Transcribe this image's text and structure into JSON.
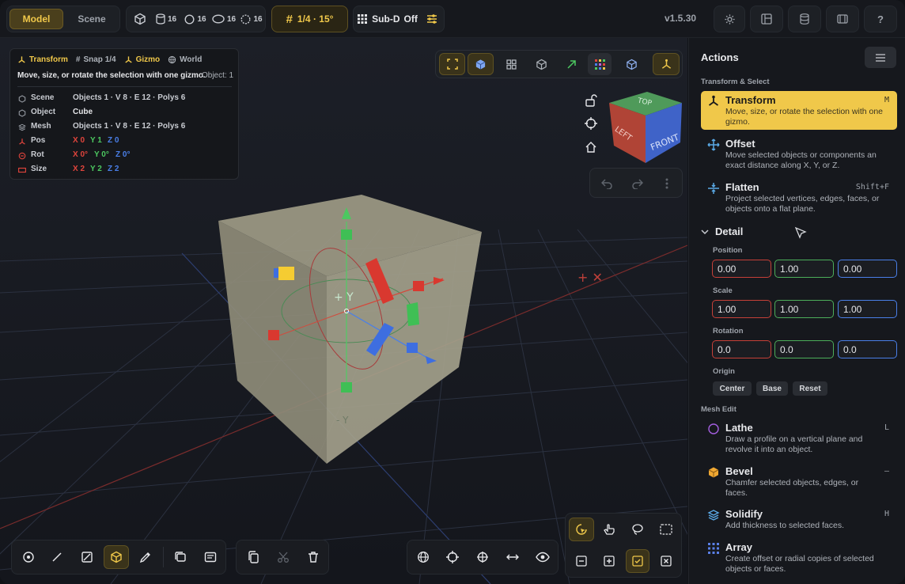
{
  "topbar": {
    "mode_tabs": [
      "Model",
      "Scene"
    ],
    "counts": [
      "16",
      "16",
      "16",
      "16"
    ],
    "snap_label": "1/4 · 15°",
    "subd_label": "Sub-D",
    "subd_state": "Off",
    "version": "v1.5.30"
  },
  "info": {
    "chips": [
      "Transform",
      "Snap 1/4",
      "Gizmo",
      "World"
    ],
    "desc": "Move, size, or rotate the selection with one gizmo.",
    "object_count": "Object: 1",
    "rows": {
      "scene": {
        "label": "Scene",
        "value": "Objects 1 · V 8 · E 12 · Polys 6"
      },
      "object": {
        "label": "Object",
        "value": "Cube"
      },
      "mesh": {
        "label": "Mesh",
        "value": "Objects 1 · V 8 · E 12 · Polys 6"
      },
      "pos": {
        "label": "Pos",
        "x": "X 0",
        "y": "Y 1",
        "z": "Z 0"
      },
      "rot": {
        "label": "Rot",
        "x": "X 0°",
        "y": "Y 0°",
        "z": "Z 0°"
      },
      "size": {
        "label": "Size",
        "x": "X 2",
        "y": "Y 2",
        "z": "Z 2"
      }
    }
  },
  "viewcube": {
    "top": "TOP",
    "left": "LEFT",
    "front": "FRONT"
  },
  "panel": {
    "title": "Actions",
    "section_transform": "Transform & Select",
    "actions": [
      {
        "title": "Transform",
        "desc": "Move, size, or rotate the selection with one gizmo.",
        "key": "M"
      },
      {
        "title": "Offset",
        "desc": "Move selected objects or components an exact distance along X, Y, or Z.",
        "key": ""
      },
      {
        "title": "Flatten",
        "desc": "Project selected vertices, edges, faces, or objects onto a flat plane.",
        "key": "Shift+F"
      }
    ],
    "detail": {
      "title": "Detail",
      "position_label": "Position",
      "position": [
        "0.00",
        "1.00",
        "0.00"
      ],
      "scale_label": "Scale",
      "scale": [
        "1.00",
        "1.00",
        "1.00"
      ],
      "rotation_label": "Rotation",
      "rotation": [
        "0.0",
        "0.0",
        "0.0"
      ],
      "origin_label": "Origin",
      "origin_buttons": [
        "Center",
        "Base",
        "Reset"
      ]
    },
    "section_mesh": "Mesh Edit",
    "mesh_actions": [
      {
        "title": "Lathe",
        "desc": "Draw a profile on a vertical plane and revolve it into an object.",
        "key": "L"
      },
      {
        "title": "Bevel",
        "desc": "Chamfer selected objects, edges, or faces.",
        "key": "–"
      },
      {
        "title": "Solidify",
        "desc": "Add thickness to selected faces.",
        "key": "H"
      },
      {
        "title": "Array",
        "desc": "Create offset or radial copies of selected objects or faces.",
        "key": ""
      }
    ]
  },
  "colors": {
    "accent": "#f0c84a",
    "x": "#e0443c",
    "y": "#4cc860",
    "z": "#4a7fe8"
  }
}
